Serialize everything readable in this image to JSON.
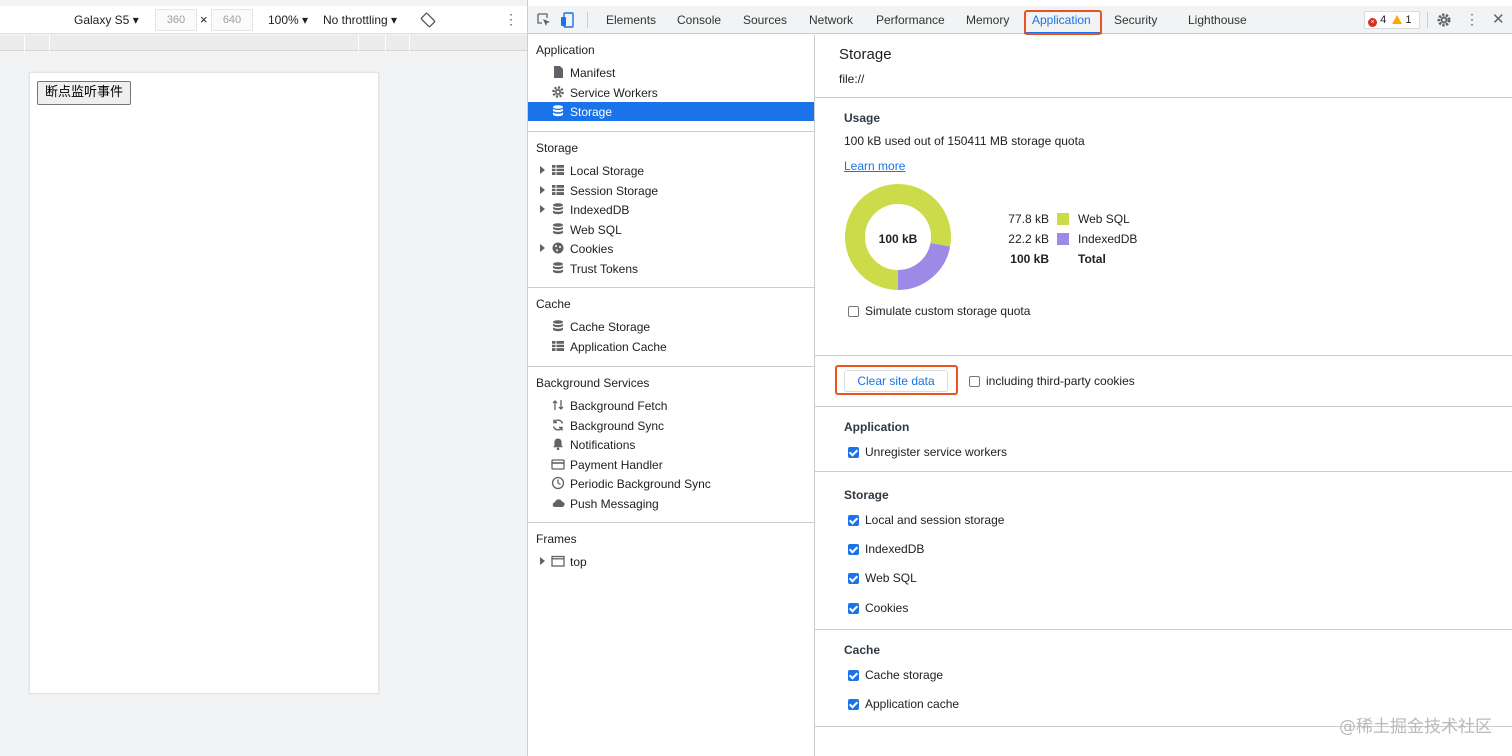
{
  "device_toolbar": {
    "device": "Galaxy S5",
    "width": "360",
    "times": "×",
    "height": "640",
    "zoom": "100%",
    "throttling": "No throttling"
  },
  "page_button": "断点监听事件",
  "devtools_tabs": [
    "Elements",
    "Console",
    "Sources",
    "Network",
    "Performance",
    "Memory",
    "Application",
    "Security",
    "Lighthouse"
  ],
  "issues": {
    "errors": "4",
    "warnings": "1"
  },
  "sidebar": {
    "sections": [
      {
        "title": "Application",
        "items": [
          {
            "label": "Manifest",
            "icon": "file-icon"
          },
          {
            "label": "Service Workers",
            "icon": "gear-icon"
          },
          {
            "label": "Storage",
            "icon": "database-icon",
            "selected": true
          }
        ]
      },
      {
        "title": "Storage",
        "items": [
          {
            "label": "Local Storage",
            "icon": "grid-icon",
            "expandable": true
          },
          {
            "label": "Session Storage",
            "icon": "grid-icon",
            "expandable": true
          },
          {
            "label": "IndexedDB",
            "icon": "database-icon",
            "expandable": true
          },
          {
            "label": "Web SQL",
            "icon": "database-icon"
          },
          {
            "label": "Cookies",
            "icon": "cookie-icon",
            "expandable": true
          },
          {
            "label": "Trust Tokens",
            "icon": "database-icon"
          }
        ]
      },
      {
        "title": "Cache",
        "items": [
          {
            "label": "Cache Storage",
            "icon": "database-icon"
          },
          {
            "label": "Application Cache",
            "icon": "grid-icon"
          }
        ]
      },
      {
        "title": "Background Services",
        "items": [
          {
            "label": "Background Fetch",
            "icon": "arrows-updown-icon"
          },
          {
            "label": "Background Sync",
            "icon": "sync-icon"
          },
          {
            "label": "Notifications",
            "icon": "bell-icon"
          },
          {
            "label": "Payment Handler",
            "icon": "card-icon"
          },
          {
            "label": "Periodic Background Sync",
            "icon": "clock-icon"
          },
          {
            "label": "Push Messaging",
            "icon": "cloud-icon"
          }
        ]
      },
      {
        "title": "Frames",
        "items": [
          {
            "label": "top",
            "icon": "frame-icon",
            "expandable": true
          }
        ]
      }
    ]
  },
  "main": {
    "title": "Storage",
    "origin": "file://",
    "usage_heading": "Usage",
    "usage_text": "100 kB used out of 150411 MB storage quota",
    "learn_more": "Learn more",
    "donut_center": "100 kB",
    "legend": [
      {
        "value": "77.8 kB",
        "label": "Web SQL",
        "color": "#ccdb4a"
      },
      {
        "value": "22.2 kB",
        "label": "IndexedDB",
        "color": "#9c8ae6"
      },
      {
        "value": "100 kB",
        "label": "Total"
      }
    ],
    "simulate_quota": "Simulate custom storage quota",
    "clear_button": "Clear site data",
    "third_party": "including third-party cookies",
    "app_heading": "Application",
    "app_items": [
      "Unregister service workers"
    ],
    "storage_heading": "Storage",
    "storage_items": [
      "Local and session storage",
      "IndexedDB",
      "Web SQL",
      "Cookies"
    ],
    "cache_heading": "Cache",
    "cache_items": [
      "Cache storage",
      "Application cache"
    ]
  },
  "chart_data": {
    "type": "pie",
    "categories": [
      "Web SQL",
      "IndexedDB"
    ],
    "values": [
      77.8,
      22.2
    ],
    "unit": "kB",
    "colors": [
      "#ccdb4a",
      "#9c8ae6"
    ]
  },
  "watermark": "@稀土掘金技术社区",
  "colors": {
    "accent": "#1a73e8",
    "highlight": "#e9531f"
  }
}
